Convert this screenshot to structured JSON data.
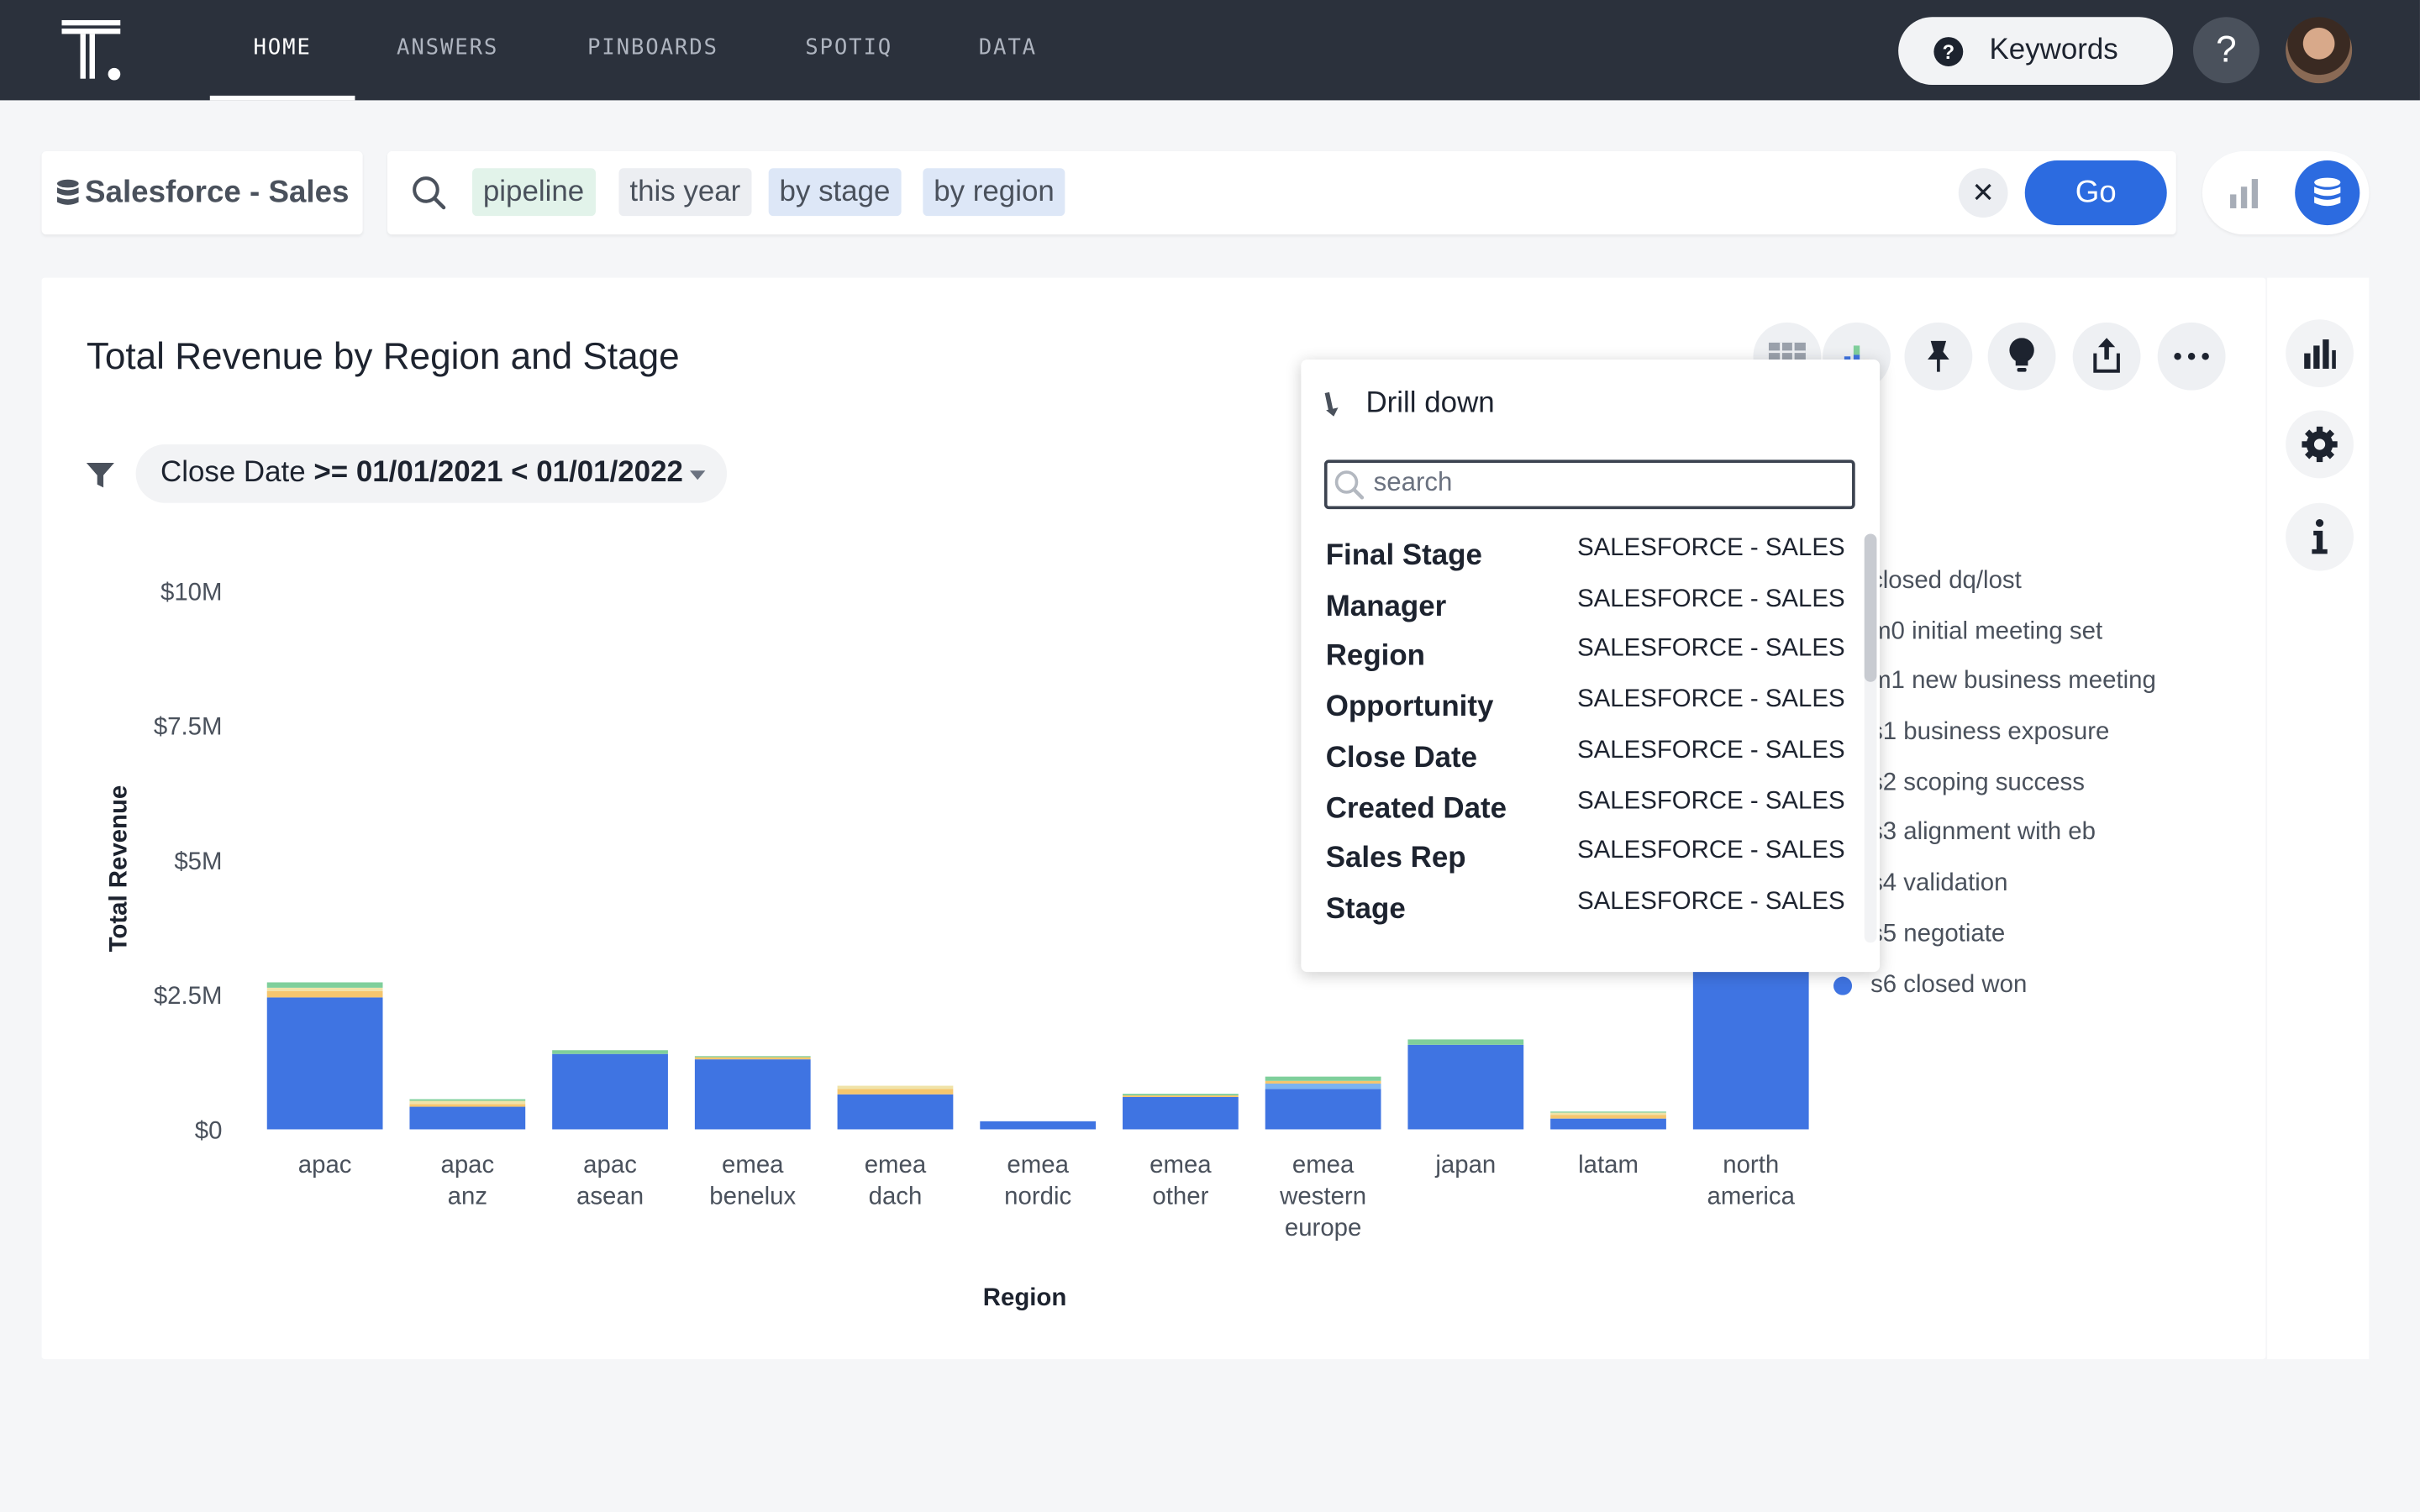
{
  "nav": {
    "items": [
      {
        "label": "HOME",
        "active": true
      },
      {
        "label": "ANSWERS",
        "active": false
      },
      {
        "label": "PINBOARDS",
        "active": false
      },
      {
        "label": "SPOTIQ",
        "active": false
      },
      {
        "label": "DATA",
        "active": false
      }
    ],
    "keywords_label": "Keywords",
    "help_label": "?"
  },
  "search": {
    "source_label": "Salesforce - Sales",
    "tokens": [
      {
        "label": "pipeline",
        "color": "#e2f3ea"
      },
      {
        "label": "this year",
        "color": "#eceef2"
      },
      {
        "label": "by stage",
        "color": "#dde7f7"
      },
      {
        "label": "by region",
        "color": "#dde7f7"
      }
    ],
    "clear_label": "✕",
    "go_label": "Go"
  },
  "answer": {
    "title": "Total Revenue by Region and Stage",
    "filter": {
      "field": "Close Date",
      "condition": ">= 01/01/2021 < 01/01/2022"
    }
  },
  "chart_data": {
    "type": "bar",
    "stacked": true,
    "xlabel": "Region",
    "ylabel": "Total Revenue",
    "y_ticks": [
      "$0",
      "$2.5M",
      "$5M",
      "$7.5M",
      "$10M"
    ],
    "ylim": [
      0,
      10000000
    ],
    "categories": [
      [
        "apac"
      ],
      [
        "apac",
        "anz"
      ],
      [
        "apac",
        "asean"
      ],
      [
        "emea",
        "benelux"
      ],
      [
        "emea",
        "dach"
      ],
      [
        "emea",
        "nordic"
      ],
      [
        "emea",
        "other"
      ],
      [
        "emea",
        "western",
        "europe"
      ],
      [
        "japan"
      ],
      [
        "latam"
      ],
      [
        "north",
        "america"
      ]
    ],
    "series": [
      {
        "name": "s6 closed won",
        "color": "#3f74e2",
        "values": [
          2450000,
          420000,
          1400000,
          1300000,
          650000,
          150000,
          600000,
          750000,
          1570000,
          200000,
          3100000
        ]
      },
      {
        "name": "s5 negotiate",
        "color": "#7bb3f0",
        "values": [
          0,
          0,
          0,
          0,
          0,
          0,
          0,
          100000,
          0,
          0,
          0
        ]
      },
      {
        "name": "s4 validation",
        "color": "#f5c66e",
        "values": [
          120000,
          50000,
          0,
          40000,
          100000,
          0,
          30000,
          50000,
          0,
          70000,
          0
        ]
      },
      {
        "name": "s3 alignment with eb",
        "color": "#f0e3a8",
        "values": [
          60000,
          60000,
          0,
          0,
          60000,
          0,
          0,
          0,
          0,
          40000,
          0
        ]
      },
      {
        "name": "s2 scoping success",
        "color": "#7fcf9b",
        "values": [
          100000,
          30000,
          70000,
          20000,
          0,
          0,
          30000,
          80000,
          100000,
          20000,
          0
        ]
      }
    ],
    "legend_visible": [
      {
        "label": "closed dq/lost",
        "color": "#8c59d9"
      },
      {
        "label": "m0 initial meeting set",
        "color": "#e37b62"
      },
      {
        "label": "m1 new business meeting",
        "color": "#56b4c8"
      },
      {
        "label": "s1 business exposure",
        "color": "#c860a6"
      },
      {
        "label": "s2 scoping success",
        "color": "#7fcf9b"
      },
      {
        "label": "s3 alignment with eb",
        "color": "#f0e3a8"
      },
      {
        "label": "s4 validation",
        "color": "#f5c66e"
      },
      {
        "label": "s5 negotiate",
        "color": "#7bb3f0"
      },
      {
        "label": "s6 closed won",
        "color": "#3f74e2"
      }
    ]
  },
  "drilldown": {
    "title": "Drill down",
    "search_placeholder": "search",
    "items": [
      {
        "name": "Final Stage",
        "source": "SALESFORCE - SALES"
      },
      {
        "name": "Manager",
        "source": "SALESFORCE - SALES"
      },
      {
        "name": "Region",
        "source": "SALESFORCE - SALES"
      },
      {
        "name": "Opportunity",
        "source": "SALESFORCE - SALES"
      },
      {
        "name": "Close Date",
        "source": "SALESFORCE - SALES"
      },
      {
        "name": "Created Date",
        "source": "SALESFORCE - SALES"
      },
      {
        "name": "Sales Rep",
        "source": "SALESFORCE - SALES"
      },
      {
        "name": "Stage",
        "source": "SALESFORCE - SALES"
      }
    ]
  }
}
